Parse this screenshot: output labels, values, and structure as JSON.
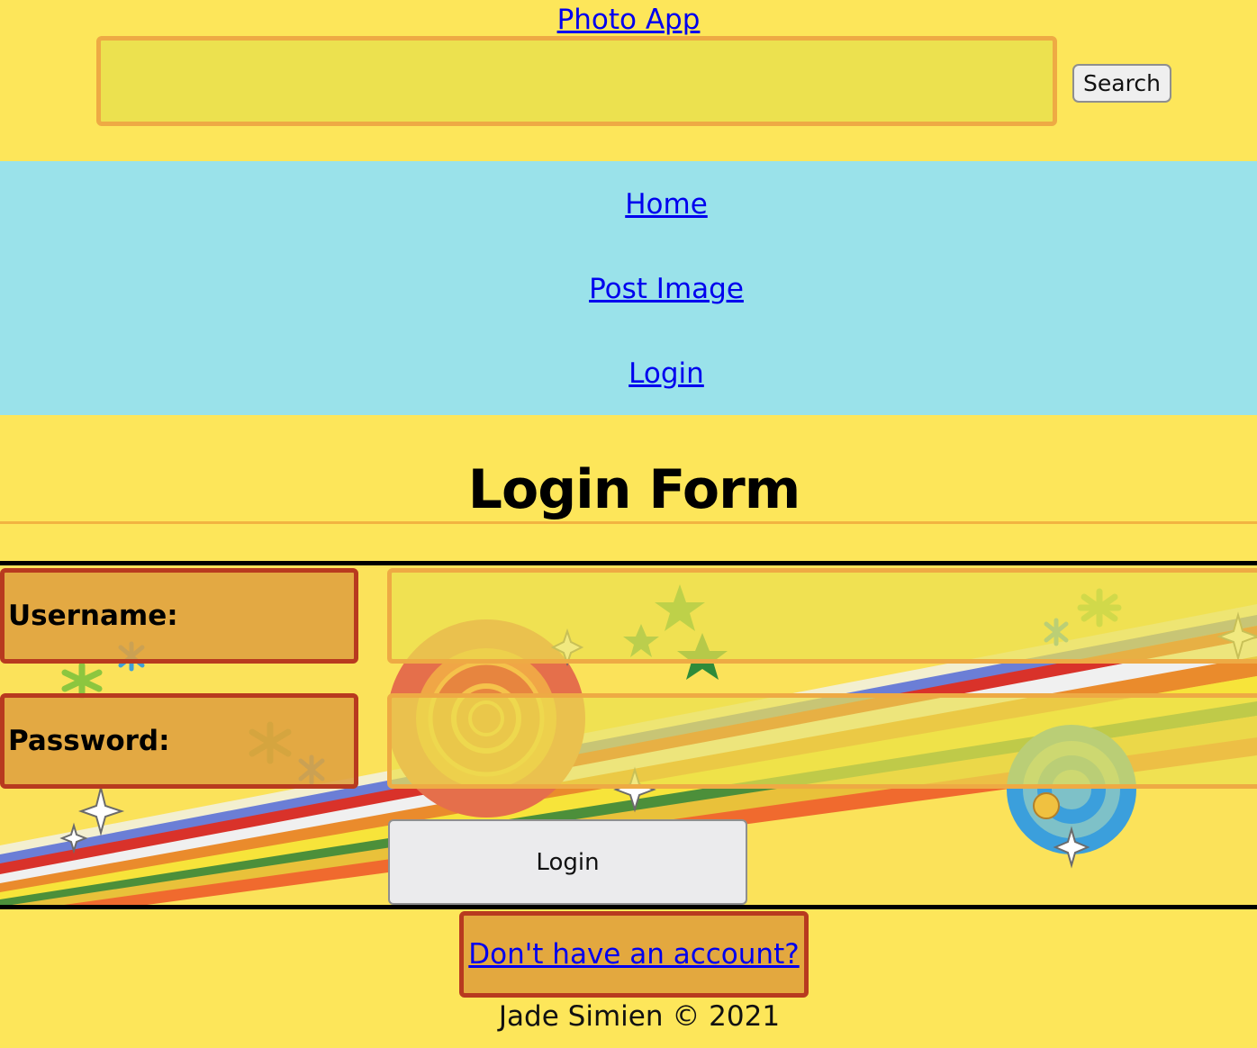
{
  "header": {
    "app_title": "Photo App",
    "search_value": "",
    "search_button": "Search"
  },
  "nav": {
    "items": [
      {
        "label": "Home"
      },
      {
        "label": "Post Image"
      },
      {
        "label": "Login"
      }
    ]
  },
  "main": {
    "heading": "Login Form",
    "username_label": "Username:",
    "username_value": "",
    "password_label": "Password:",
    "password_value": "",
    "login_button": "Login"
  },
  "footer": {
    "register_link": "Don't have an account?",
    "copyright": "Jade Simien © 2021"
  },
  "colors": {
    "page_background": "#fde65a",
    "nav_background": "#9ae2ea",
    "input_border": "#eeaa44",
    "label_border": "#b83a1f",
    "label_background": "#dfa040",
    "link": "#0000ee"
  }
}
